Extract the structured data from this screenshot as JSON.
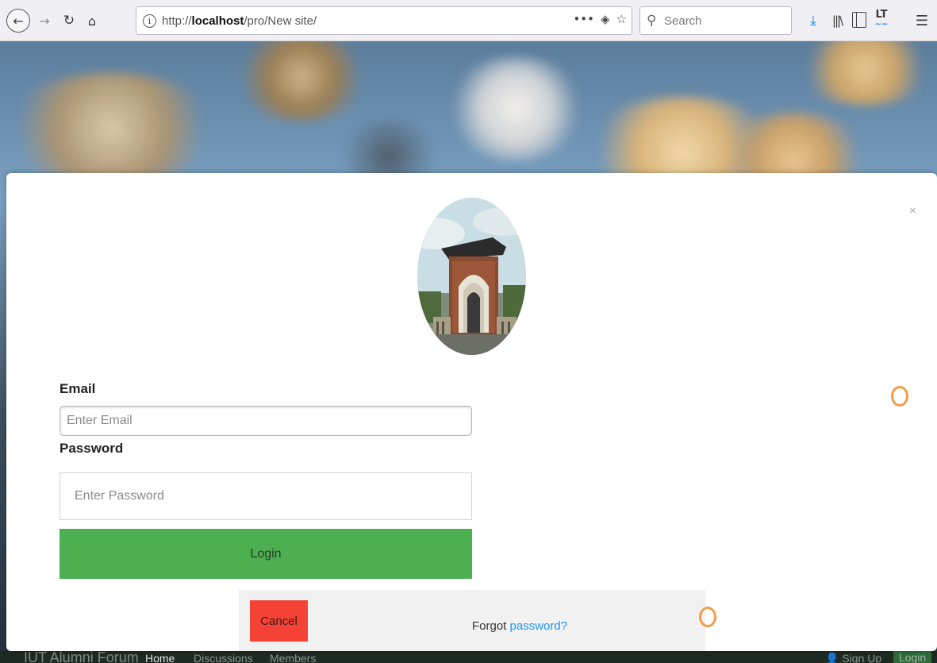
{
  "browser": {
    "url_prefix": "http://",
    "url_host": "localhost",
    "url_path": "/pro/New site/",
    "search_placeholder": "Search",
    "icons": [
      "back-icon",
      "forward-icon",
      "reload-icon",
      "home-icon",
      "info-icon",
      "more-icon",
      "pocket-icon",
      "bookmark-star-icon",
      "search-icon",
      "download-icon",
      "library-icon",
      "sidebar-icon",
      "languagetool-icon",
      "menu-icon"
    ]
  },
  "site_nav": {
    "brand": "IUT Alumni Forum",
    "home": "Home",
    "discussions": "Discussions",
    "members": "Members",
    "sign_up": "Sign Up",
    "login": "Login"
  },
  "modal": {
    "close": "×",
    "email_label": "Email",
    "email_placeholder": "Enter Email",
    "password_label": "Password",
    "password_placeholder": "Enter Password",
    "login_button": "Login",
    "cancel_button": "Cancel",
    "forgot_prefix": "Forgot",
    "forgot_link": "password?"
  },
  "colors": {
    "login_green": "#4caf50",
    "cancel_red": "#f44336",
    "link_blue": "#2196f3",
    "ring_orange": "#f39c4a"
  }
}
